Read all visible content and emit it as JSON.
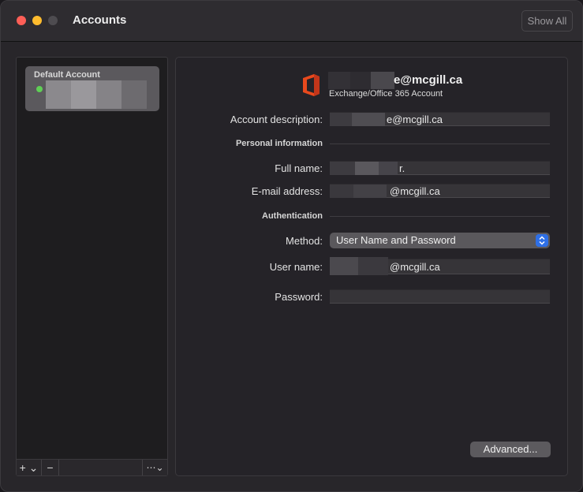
{
  "window": {
    "title": "Accounts",
    "show_all_label": "Show All"
  },
  "sidebar": {
    "account_label": "Default Account",
    "status_color": "#5fcf55",
    "add_label": "+ ⌄",
    "remove_label": "−",
    "more_label": "⋯⌄"
  },
  "header": {
    "icon": "office-365-icon",
    "email_visible": "e@mcgill.ca",
    "account_type": "Exchange/Office 365 Account"
  },
  "form": {
    "account_description_label": "Account description:",
    "account_description_value": "e@mcgill.ca",
    "personal_info_heading": "Personal information",
    "full_name_label": "Full name:",
    "full_name_value": "r.",
    "email_label": "E-mail address:",
    "email_value": "@mcgill.ca",
    "auth_heading": "Authentication",
    "method_label": "Method:",
    "method_value": "User Name and Password",
    "username_label": "User name:",
    "username_value": "@mcgill.ca",
    "password_label": "Password:",
    "password_value": ""
  },
  "advanced_label": "Advanced...",
  "colors": {
    "accent": "#2e6fe6",
    "close": "#fe5f57",
    "minimize": "#febc2e"
  }
}
